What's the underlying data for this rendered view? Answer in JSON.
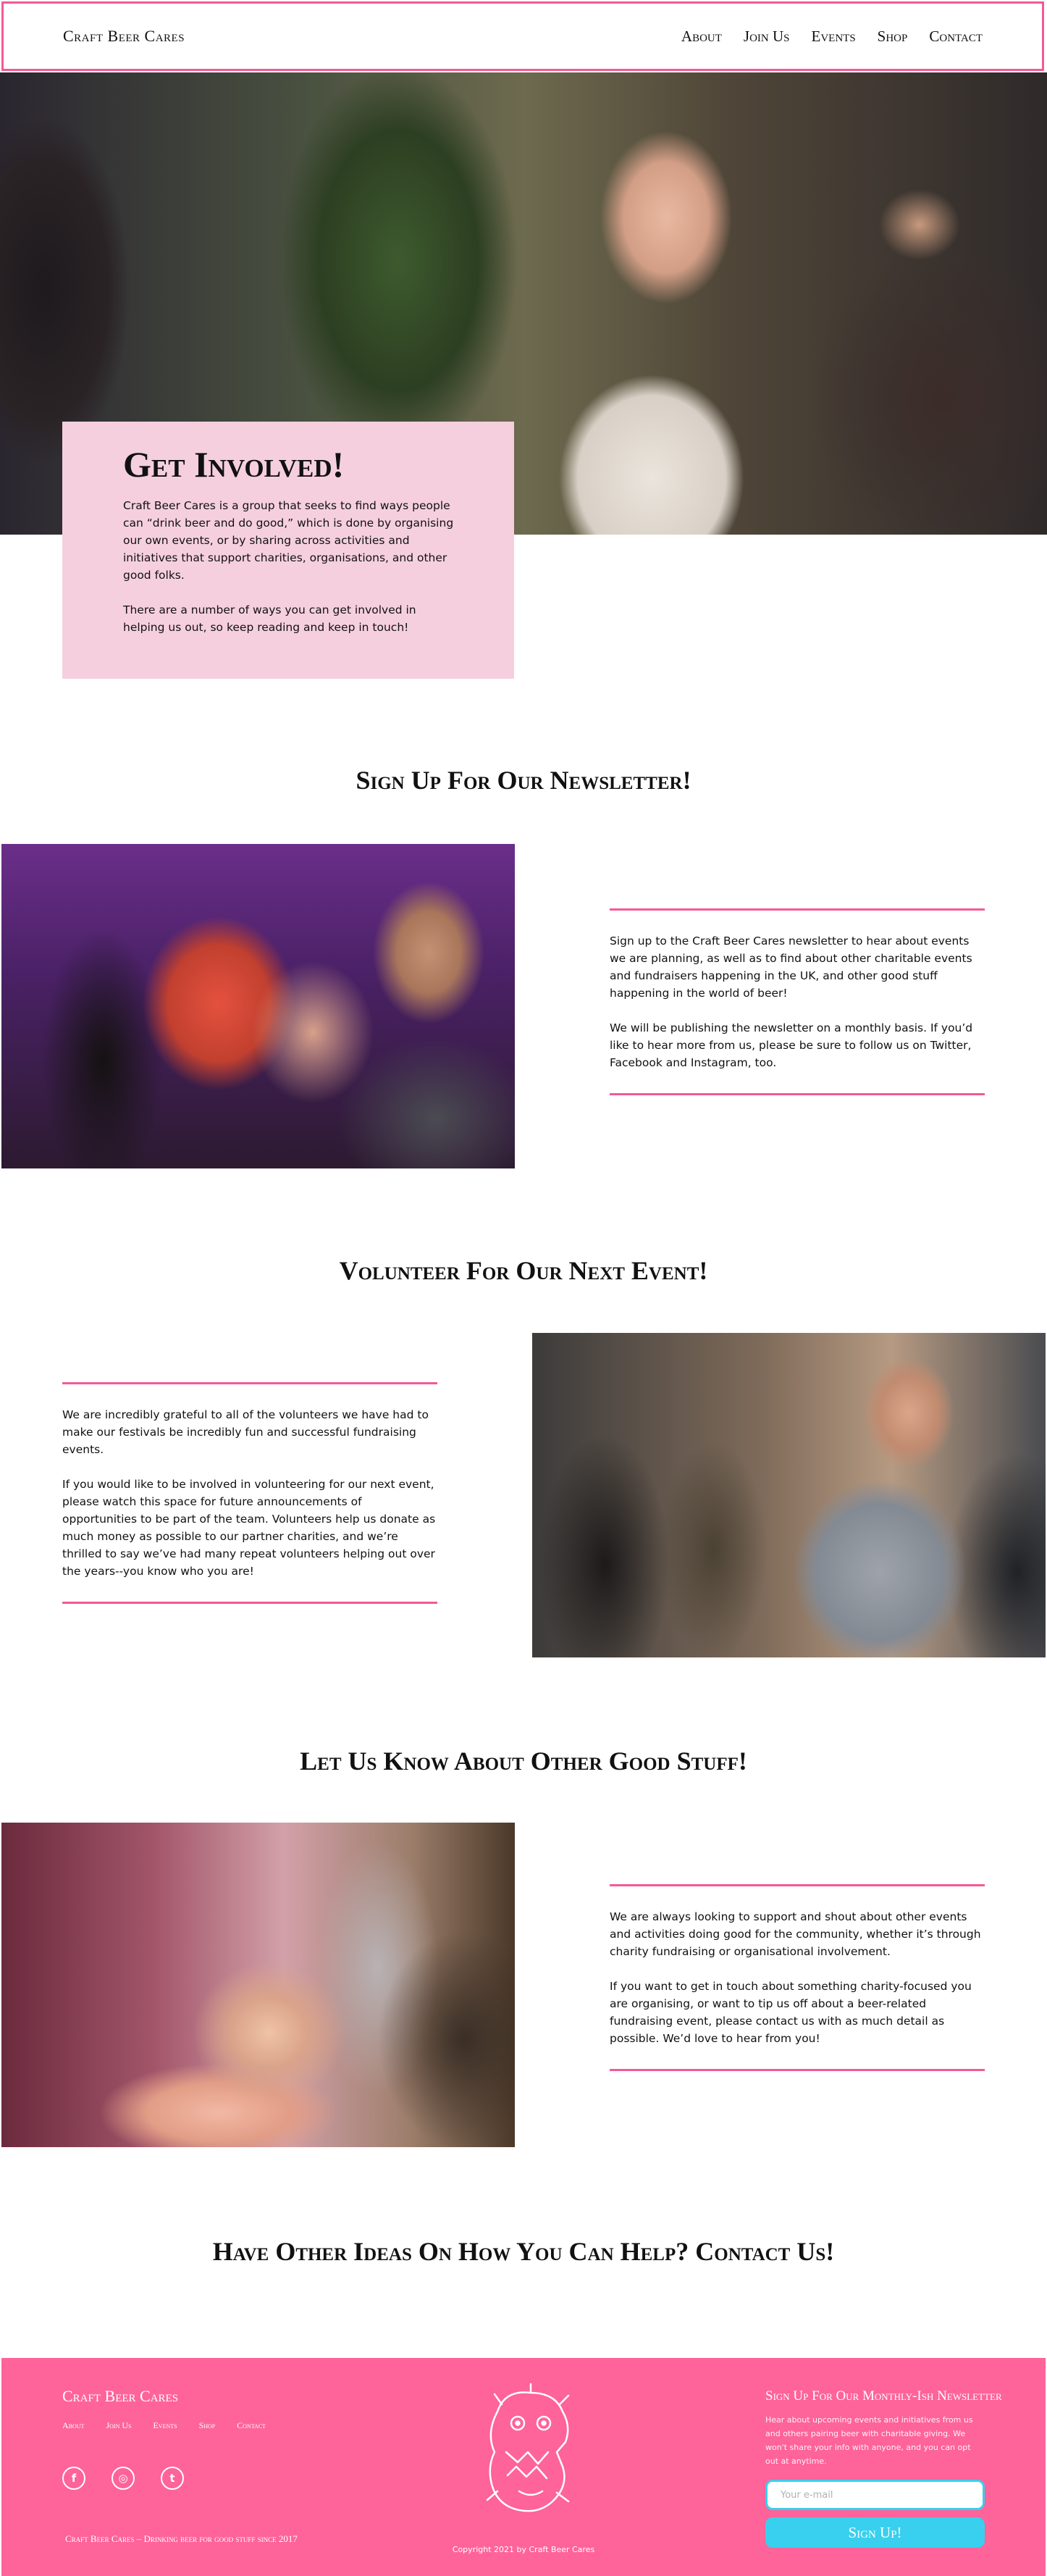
{
  "header": {
    "logo": "Craft Beer Cares",
    "nav": [
      "About",
      "Join Us",
      "Events",
      "Shop",
      "Contact"
    ]
  },
  "hero": {
    "title": "Get Involved!",
    "paragraphs": [
      "Craft Beer Cares is a group that seeks to find ways people can “drink beer and do good,” which is done by organising our own events, or by sharing across activities and initiatives that support charities, organisations, and other good folks.",
      "There are a number of ways you can get involved in helping us out, so keep reading and keep in touch!"
    ]
  },
  "newsletter": {
    "title": "Sign Up For Our Newsletter!",
    "paragraphs": [
      "Sign up to the Craft Beer Cares newsletter to hear about events we are planning, as well as to find about other charitable events and fundraisers happening in the UK, and other good stuff happening in the world of beer!",
      "We will be publishing the newsletter on a monthly basis. If you’d like to hear more from us, please be sure to follow us on Twitter, Facebook and Instagram, too."
    ]
  },
  "volunteer": {
    "title": "Volunteer For Our Next Event!",
    "paragraphs": [
      "We are incredibly grateful to all of the volunteers we have had to make our festivals be incredibly fun and successful fundraising events.",
      "If you would like to be involved in volunteering for our next event, please watch this space for future announcements of opportunities to be part of the team. Volunteers help us donate as much money as possible to our partner charities, and we’re thrilled to say we’ve had many repeat volunteers helping out over the years--you know who you are!"
    ]
  },
  "good_stuff": {
    "title": "Let Us Know About Other Good Stuff!",
    "paragraphs": [
      "We are always looking to support and shout about other events and activities doing good for the community, whether it’s through charity fundraising or organisational involvement.",
      "If you want to get in touch about something charity-focused you are organising, or want to tip us off about a beer-related fundraising event, please contact us with as much detail as possible. We’d love to hear from you!"
    ]
  },
  "contact_cta": {
    "title": "Have Other Ideas On How You Can Help? Contact Us!"
  },
  "footer": {
    "brand": "Craft Beer Cares",
    "nav": [
      "About",
      "Join Us",
      "Events",
      "Shop",
      "Contact"
    ],
    "social": [
      {
        "icon": "facebook-icon",
        "glyph": "f"
      },
      {
        "icon": "instagram-icon",
        "glyph": "◎"
      },
      {
        "icon": "twitter-icon",
        "glyph": "t"
      }
    ],
    "tagline": "Craft Beer Cares – Drinking beer for good stuff since 2017",
    "copyright": "Copyright 2021 by Craft Beer Cares",
    "subscribe": {
      "title": "Sign Up For Our Monthly-Ish Newsletter",
      "description": "Hear about upcoming events and initiatives from us and others pairing beer with charitable giving. We won't share your info with anyone, and you can opt out at anytime.",
      "email_placeholder": "Your e-mail",
      "button": "Sign Up!"
    }
  },
  "colors": {
    "accent_pink": "#fe6399",
    "rule_pink": "#f35a95",
    "card_pink": "#f6cfdf",
    "button_cyan": "#38d0ee"
  }
}
